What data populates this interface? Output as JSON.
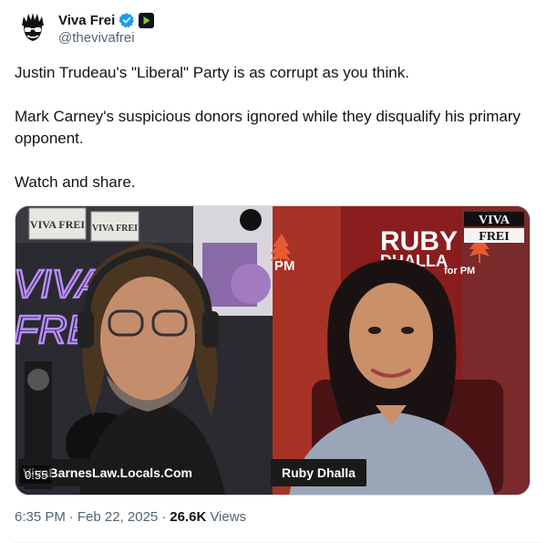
{
  "author": {
    "display_name": "Viva Frei",
    "handle": "@thevivafrei",
    "verified_icon": "verified-badge-icon",
    "secondary_icon": "rumble-icon"
  },
  "tweet": {
    "paragraphs": [
      "Justin Trudeau's \"Liberal\" Party is as corrupt as you think.",
      "Mark Carney's suspicious donors ignored while they disqualify his primary opponent.",
      "Watch and share."
    ]
  },
  "media": {
    "duration": "0:55",
    "left_caption": "VivaBarnesLaw.Locals.Com",
    "right_caption": "Ruby Dhalla",
    "poster_ruby": "RUBY",
    "poster_dhalla": "DHALLA",
    "poster_for_pm": "for PM",
    "poster_pm_left": "PM",
    "watermark_line1": "VIVA",
    "watermark_line2": "FREI",
    "wall_sign_1": "VIVA FREI",
    "wall_sign_2": "VIVA FREI",
    "neon_1": "VIVA",
    "neon_2": "FREI"
  },
  "meta": {
    "time": "6:35 PM",
    "separator": "·",
    "date": "Feb 22, 2025",
    "separator2": "·",
    "views_count": "26.6K",
    "views_label": "Views"
  },
  "colors": {
    "verified_blue": "#1d9bf0",
    "rumble_green": "#85c742",
    "secondary_text": "#536471",
    "maple_red": "#d43b2a"
  }
}
